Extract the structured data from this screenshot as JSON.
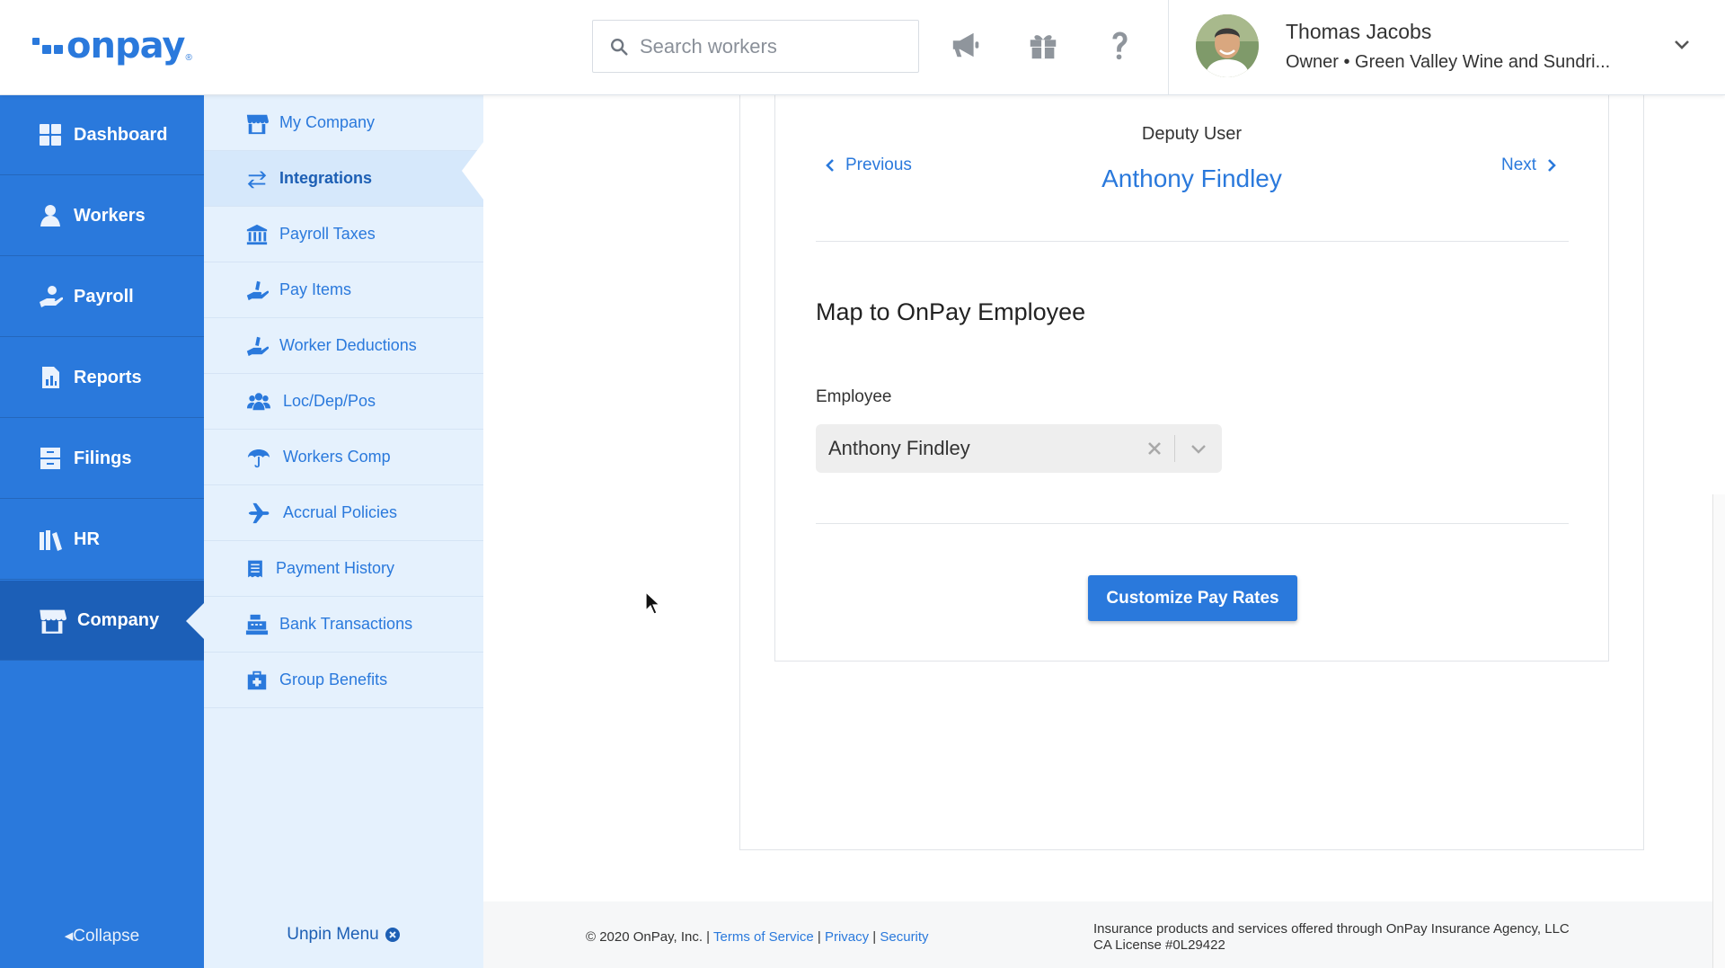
{
  "header": {
    "logo_text": "onpay",
    "logo_reg": "®",
    "search_placeholder": "Search workers",
    "icons": [
      "megaphone-icon",
      "gift-icon",
      "help-icon"
    ],
    "user": {
      "name": "Thomas Jacobs",
      "role": "Owner • Green Valley Wine and Sundri..."
    }
  },
  "sidebar": {
    "items": [
      {
        "label": "Dashboard",
        "icon": "dashboard-icon"
      },
      {
        "label": "Workers",
        "icon": "workers-icon"
      },
      {
        "label": "Payroll",
        "icon": "payroll-icon"
      },
      {
        "label": "Reports",
        "icon": "reports-icon"
      },
      {
        "label": "Filings",
        "icon": "filings-icon"
      },
      {
        "label": "HR",
        "icon": "hr-icon"
      },
      {
        "label": "Company",
        "icon": "company-icon"
      }
    ],
    "active": "Company",
    "collapse_label": "Collapse"
  },
  "subnav": {
    "items": [
      {
        "label": "My Company",
        "icon": "storefront-icon"
      },
      {
        "label": "Integrations",
        "icon": "arrows-exchange-icon"
      },
      {
        "label": "Payroll Taxes",
        "icon": "bank-icon"
      },
      {
        "label": "Pay Items",
        "icon": "hand-money-icon"
      },
      {
        "label": "Worker Deductions",
        "icon": "hand-money-icon"
      },
      {
        "label": "Loc/Dep/Pos",
        "icon": "group-icon"
      },
      {
        "label": "Workers Comp",
        "icon": "umbrella-icon"
      },
      {
        "label": "Accrual Policies",
        "icon": "airplane-icon"
      },
      {
        "label": "Payment History",
        "icon": "receipt-icon"
      },
      {
        "label": "Bank Transactions",
        "icon": "cash-register-icon"
      },
      {
        "label": "Group Benefits",
        "icon": "medical-kit-icon"
      }
    ],
    "active": "Integrations",
    "unpin_label": "Unpin Menu"
  },
  "main": {
    "deputy_label": "Deputy User",
    "employee_name": "Anthony Findley",
    "previous_label": "Previous",
    "next_label": "Next",
    "section_title": "Map to OnPay Employee",
    "employee_field_label": "Employee",
    "employee_selected": "Anthony Findley",
    "customize_button": "Customize Pay Rates"
  },
  "footer": {
    "copyright": "© 2020 OnPay, Inc. |",
    "terms": "Terms of Service",
    "sep1": "|",
    "privacy": "Privacy",
    "sep2": "|",
    "security": "Security",
    "insurance_line1": "Insurance products and services offered through OnPay Insurance Agency, LLC",
    "insurance_line2": "CA License #0L29422"
  },
  "colors": {
    "brand_blue": "#2a79dc",
    "sidebar_active": "#1c5fb7",
    "subnav_bg": "#e5f1fd"
  }
}
